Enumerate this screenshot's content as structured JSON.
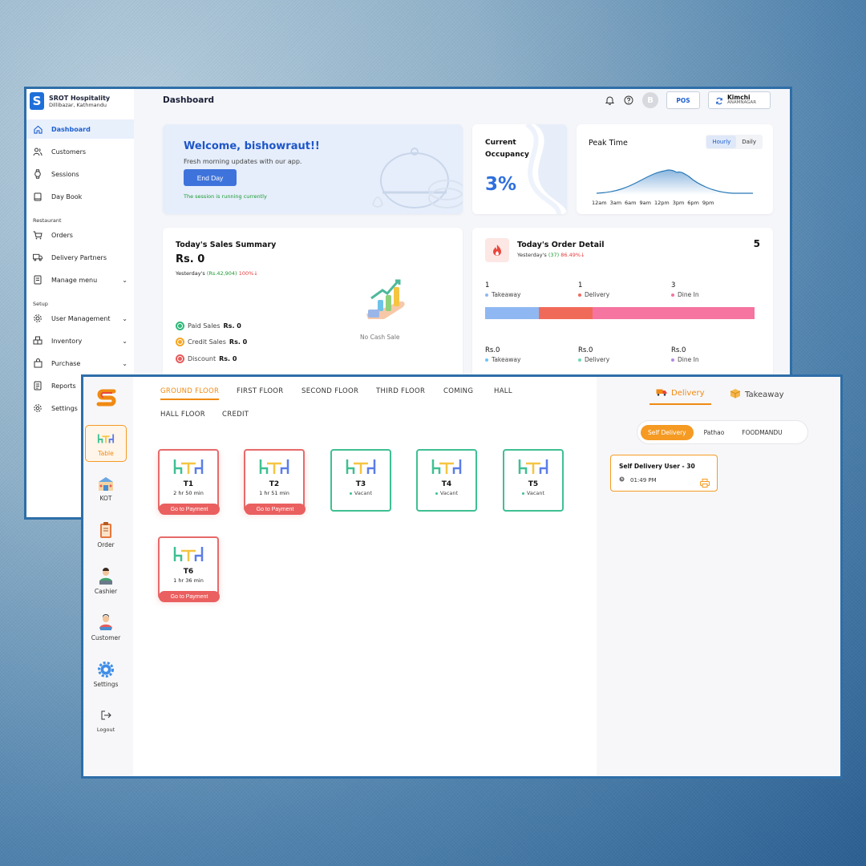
{
  "dashboard": {
    "brand": {
      "logo": "S",
      "name": "SROT Hospitality",
      "location": "Dillibazar, Kathmandu"
    },
    "sidebar": {
      "items": [
        {
          "label": "Dashboard",
          "icon": "home-icon",
          "active": true
        },
        {
          "label": "Customers",
          "icon": "users-icon"
        },
        {
          "label": "Sessions",
          "icon": "watch-icon"
        },
        {
          "label": "Day Book",
          "icon": "book-icon"
        }
      ],
      "section_restaurant": "Restaurant",
      "restaurant_items": [
        {
          "label": "Orders",
          "icon": "cart-icon"
        },
        {
          "label": "Delivery Partners",
          "icon": "truck-icon"
        },
        {
          "label": "Manage menu",
          "icon": "menu-book-icon"
        }
      ],
      "section_setup": "Setup",
      "setup_items": [
        {
          "label": "User Management",
          "icon": "gear-icon"
        },
        {
          "label": "Inventory",
          "icon": "boxes-icon"
        },
        {
          "label": "Purchase",
          "icon": "bag-icon"
        },
        {
          "label": "Reports",
          "icon": "report-icon"
        },
        {
          "label": "Settings",
          "icon": "settings-icon"
        }
      ]
    },
    "title": "Dashboard",
    "topbar": {
      "avatar": "B",
      "pos_label": "POS",
      "branch_name": "Kimchi",
      "branch_sub": "ANAMNAGAR"
    },
    "welcome": {
      "title": "Welcome, bishowraut!!",
      "subtitle": "Fresh morning updates with our app.",
      "button": "End Day",
      "session_status": "The session is running currently"
    },
    "occupancy": {
      "label": "Current Occupancy",
      "value": "3%"
    },
    "peak": {
      "title": "Peak Time",
      "toggle": [
        "Hourly",
        "Daily"
      ],
      "active_toggle": "Hourly",
      "ticks": [
        "12am",
        "3am",
        "6am",
        "9am",
        "12pm",
        "3pm",
        "6pm",
        "9pm"
      ]
    },
    "sales": {
      "title": "Today's Sales Summary",
      "value": "Rs. 0",
      "yesterday_prefix": "Yesterday's",
      "yesterday_value": "(Rs.42,904)",
      "yesterday_change": "100%↓",
      "rows": [
        {
          "label": "Paid Sales",
          "value": "Rs. 0",
          "color": "#2fb97a"
        },
        {
          "label": "Credit Sales",
          "value": "Rs. 0",
          "color": "#f5a623"
        },
        {
          "label": "Discount",
          "value": "Rs. 0",
          "color": "#e85b5b"
        }
      ],
      "empty_label": "No Cash Sale"
    },
    "orders": {
      "title": "Today's Order Detail",
      "count": "5",
      "yesterday_prefix": "Yesterday's",
      "yesterday_value": "(37)",
      "yesterday_change": "86.49%↓",
      "types": [
        {
          "count": "1",
          "label": "Takeaway",
          "color": "#8fb8f2",
          "amount": "Rs.0",
          "amount_dot": "#6bc6f0"
        },
        {
          "count": "1",
          "label": "Delivery",
          "color": "#f06a5a",
          "amount": "Rs.0",
          "amount_dot": "#6fd7b8"
        },
        {
          "count": "3",
          "label": "Dine In",
          "color": "#f574a0",
          "amount": "Rs.0",
          "amount_dot": "#b48ae8"
        }
      ]
    }
  },
  "pos": {
    "sidebar": [
      {
        "label": "Table",
        "icon": "table-icon",
        "active": true
      },
      {
        "label": "KOT",
        "icon": "kitchen-icon"
      },
      {
        "label": "Order",
        "icon": "clipboard-icon"
      },
      {
        "label": "Cashier",
        "icon": "cashier-icon"
      },
      {
        "label": "Customer",
        "icon": "customer-icon"
      },
      {
        "label": "Settings",
        "icon": "gear-icon"
      },
      {
        "label": "Logout",
        "icon": "logout-icon"
      }
    ],
    "floors": [
      "GROUND FLOOR",
      "FIRST FLOOR",
      "SECOND FLOOR",
      "THIRD FLOOR",
      "COMING",
      "HALL",
      "HALL FLOOR",
      "CREDIT"
    ],
    "active_floor": "GROUND FLOOR",
    "tables": [
      {
        "name": "T1",
        "status": "occupied",
        "time": "2 hr 50 min",
        "action": "Go to Payment"
      },
      {
        "name": "T2",
        "status": "occupied",
        "time": "1 hr 51 min",
        "action": "Go to Payment"
      },
      {
        "name": "T3",
        "status": "vacant",
        "label": "Vacant"
      },
      {
        "name": "T4",
        "status": "vacant",
        "label": "Vacant"
      },
      {
        "name": "T5",
        "status": "vacant",
        "label": "Vacant"
      },
      {
        "name": "T6",
        "status": "occupied",
        "time": "1 hr 36 min",
        "action": "Go to Payment"
      }
    ],
    "order_tabs": [
      "Delivery",
      "Takeaway"
    ],
    "active_order_tab": "Delivery",
    "delivery_sources": [
      "Self Delivery",
      "Pathao",
      "FOODMANDU"
    ],
    "active_source": "Self Delivery",
    "delivery_card": {
      "title": "Self Delivery User - 30",
      "time": "01:49 PM"
    }
  }
}
